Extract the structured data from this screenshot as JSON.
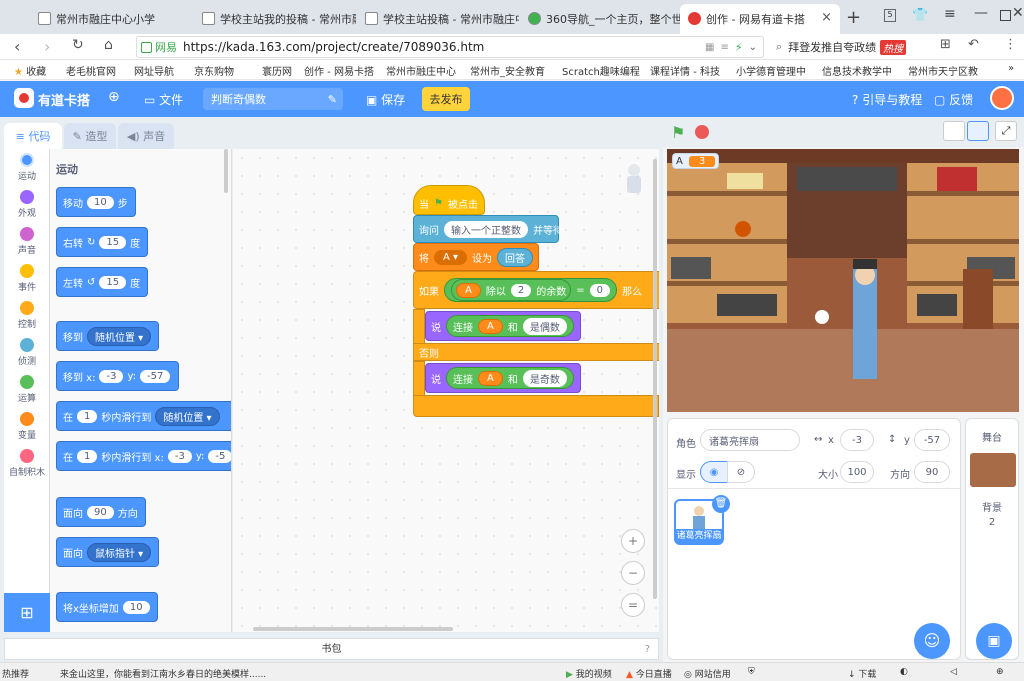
{
  "browser": {
    "tabs": [
      {
        "title": "常州市融庄中心小学"
      },
      {
        "title": "学校主站我的投稿 - 常州市融"
      },
      {
        "title": "学校主站投稿 - 常州市融庄中"
      },
      {
        "title": "360导航_一个主页，整个世界"
      },
      {
        "title": "创作 - 网易有道卡搭"
      }
    ],
    "new_tab": "+",
    "url_label": "网易",
    "url": "https://kada.163.com/project/create/7089036.htm",
    "search_text": "拜登发推自夸政绩",
    "hot_badge": "热搜",
    "bookmarks": [
      "收藏",
      "老毛桃官网",
      "网址导航",
      "京东购物",
      "寰历网",
      "创作 - 网易卡搭",
      "常州市融庄中心",
      "常州市_安全教育",
      "Scratch趣味编程",
      "课程详情 - 科技",
      "小学德育管理中",
      "信息技术教学中",
      "常州市天宁区教"
    ],
    "bookmark_more": "»"
  },
  "app": {
    "logo_text": "有道卡搭",
    "file_menu": "文件",
    "project_title": "判断奇偶数",
    "save": "保存",
    "publish": "去发布",
    "guide": "引导与教程",
    "feedback": "反馈"
  },
  "editor_tabs": {
    "code": "代码",
    "costume": "造型",
    "sound": "声音"
  },
  "categories": [
    {
      "label": "运动",
      "color": "#4c97ff"
    },
    {
      "label": "外观",
      "color": "#9966ff"
    },
    {
      "label": "声音",
      "color": "#cf63cf"
    },
    {
      "label": "事件",
      "color": "#ffbf00"
    },
    {
      "label": "控制",
      "color": "#ffab19"
    },
    {
      "label": "侦测",
      "color": "#5cb1d6"
    },
    {
      "label": "运算",
      "color": "#59c059"
    },
    {
      "label": "变量",
      "color": "#ff8c1a"
    },
    {
      "label": "自制积木",
      "color": "#ff6680"
    }
  ],
  "palette": {
    "heading": "运动",
    "move": {
      "pre": "移动",
      "val": "10",
      "post": "步"
    },
    "turn_right": {
      "pre": "右转",
      "val": "15",
      "post": "度"
    },
    "turn_left": {
      "pre": "左转",
      "val": "15",
      "post": "度"
    },
    "goto": {
      "pre": "移到",
      "menu": "随机位置"
    },
    "goto_xy": {
      "pre": "移到 x:",
      "x": "-3",
      "ylbl": "y:",
      "y": "-57"
    },
    "glide": {
      "pre": "在",
      "val": "1",
      "mid": "秒内滑行到",
      "menu": "随机位置"
    },
    "glide_xy": {
      "pre": "在",
      "val": "1",
      "mid": "秒内滑行到 x:",
      "x": "-3",
      "ylbl": "y:",
      "y": "-5"
    },
    "point": {
      "pre": "面向",
      "val": "90",
      "post": "方向"
    },
    "point_towards": {
      "pre": "面向",
      "menu": "鼠标指针"
    },
    "change_x": {
      "pre": "将x坐标增加",
      "val": "10"
    }
  },
  "script": {
    "hat": {
      "pre": "当",
      "post": "被点击"
    },
    "ask": {
      "pre": "询问",
      "val": "输入一个正整数",
      "post": "并等待"
    },
    "set": {
      "pre": "将",
      "var": "A",
      "mid": "设为",
      "val": "回答"
    },
    "if": {
      "pre": "如果",
      "var": "A",
      "mod": "除以",
      "num": "2",
      "rem": "的余数",
      "eq": "=",
      "zero": "0",
      "then": "那么"
    },
    "say1": {
      "pre": "说",
      "join": "连接",
      "var": "A",
      "and": "和",
      "text": "是偶数"
    },
    "else": "否则",
    "say2": {
      "pre": "说",
      "join": "连接",
      "var": "A",
      "and": "和",
      "text": "是奇数"
    }
  },
  "backpack": "书包",
  "stage": {
    "var_name": "A",
    "var_value": "3"
  },
  "sprite_info": {
    "sprite_label": "角色",
    "sprite_name": "诸葛亮挥扇",
    "x_label": "x",
    "x": "-3",
    "y_label": "y",
    "y": "-57",
    "show_label": "显示",
    "size_label": "大小",
    "size": "100",
    "dir_label": "方向",
    "direction": "90",
    "thumb_name": "诸葛亮挥扇"
  },
  "stage_panel": {
    "title": "舞台",
    "backdrop_label": "背景",
    "backdrop_count": "2"
  },
  "statusbar": {
    "left": "热推荐",
    "news": "来金山这里，你能看到江南水乡春日的绝美模样......",
    "my_video": "我的视频",
    "live": "今日直播",
    "credit": "网站信用",
    "download": "下载"
  }
}
